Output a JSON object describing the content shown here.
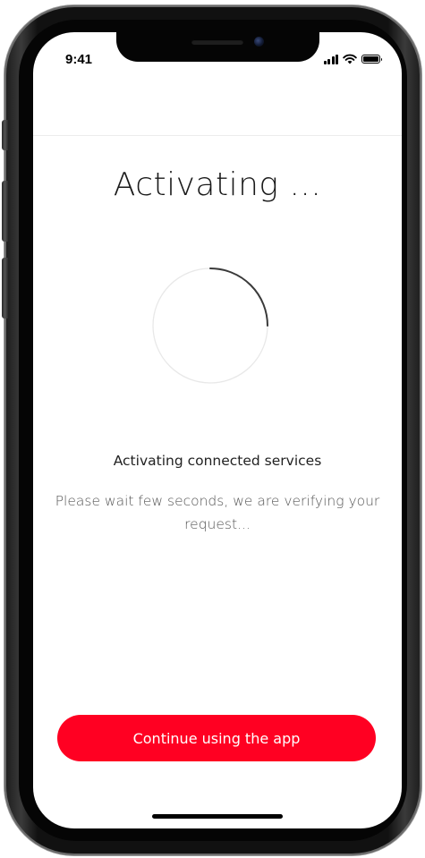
{
  "status_bar": {
    "time": "9:41",
    "icons": [
      "cellular-signal-icon",
      "wifi-icon",
      "battery-icon"
    ]
  },
  "screen": {
    "title": "Activating ...",
    "subtitle": "Activating connected services",
    "description": "Please wait few seconds, we are verifying your request..."
  },
  "spinner": {
    "progress": 0.25,
    "track_color": "#e8e8e8",
    "arc_color": "#3a3a3a"
  },
  "cta": {
    "label": "Continue using the app",
    "color": "#ff0022"
  },
  "device": {
    "icon": "iphone-frame"
  }
}
